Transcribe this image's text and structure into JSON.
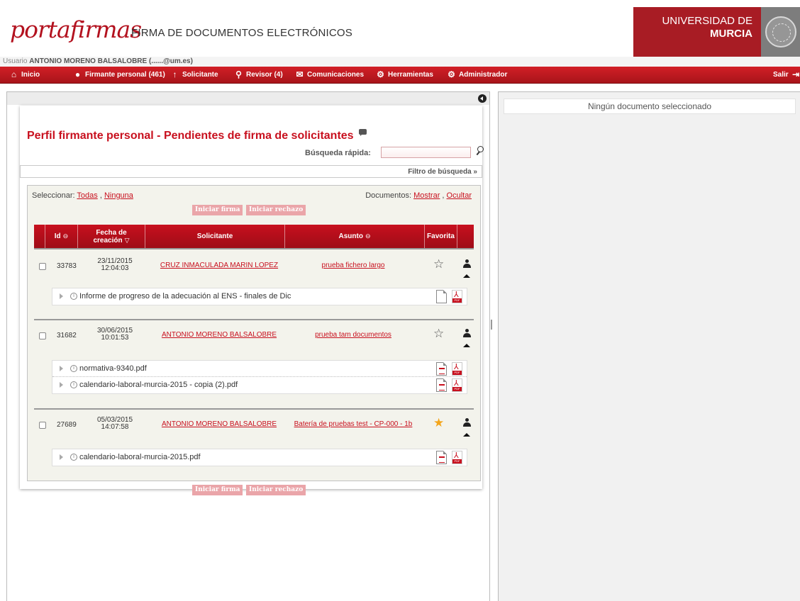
{
  "header": {
    "logo_text": "portafirmas",
    "app_title": "FIRMA DE DOCUMENTOS ELECTRÓNICOS",
    "university_line1": "UNIVERSIDAD DE",
    "university_line2": "MURCIA"
  },
  "user": {
    "prefix": "Usuario",
    "name": "ANTONIO MORENO BALSALOBRE (",
    "email_suffix": "......@um.es)"
  },
  "menu": {
    "inicio": "Inicio",
    "firmante": "Firmante personal (461)",
    "solicitante": "Solicitante",
    "revisor": "Revisor (4)",
    "comunicaciones": "Comunicaciones",
    "herramientas": "Herramientas",
    "administrador": "Administrador",
    "salir": "Salir"
  },
  "page": {
    "title": "Perfil firmante personal - Pendientes de firma de solicitantes",
    "quick_search_label": "Búsqueda rápida:",
    "quick_search_value": "",
    "filter_link": "Filtro de búsqueda »",
    "select_label": "Seleccionar:",
    "select_all": "Todas",
    "select_none": "Ninguna",
    "documents_label": "Documentos:",
    "documents_show": "Mostrar",
    "documents_hide": "Ocultar",
    "start_sign": "Iniciar firma",
    "start_reject": "Iniciar rechazo"
  },
  "table": {
    "headers": {
      "id": "Id",
      "fecha_line1": "Fecha de",
      "fecha_line2": "creación",
      "solicitante": "Solicitante",
      "asunto": "Asunto",
      "favorita": "Favorita"
    },
    "rows": [
      {
        "id": "33783",
        "date": "23/11/2015",
        "time": "12:04:03",
        "solicitante": "CRUZ INMACULADA MARIN LOPEZ",
        "asunto": "prueba fichero largo",
        "favorite": false,
        "docs": [
          "Informe de progreso de la adecuación al ENS - finales de Dic"
        ]
      },
      {
        "id": "31682",
        "date": "30/06/2015",
        "time": "10:01:53",
        "solicitante": "ANTONIO MORENO BALSALOBRE",
        "asunto": "prueba tam documentos",
        "favorite": false,
        "docs": [
          "normativa-9340.pdf",
          "calendario-laboral-murcia-2015 - copia (2).pdf"
        ]
      },
      {
        "id": "27689",
        "date": "05/03/2015",
        "time": "14:07:58",
        "solicitante": "ANTONIO MORENO BALSALOBRE",
        "asunto": "Batería de pruebas test - CP-000 - 1b",
        "favorite": true,
        "docs": [
          "calendario-laboral-murcia-2015.pdf"
        ]
      }
    ]
  },
  "preview": {
    "empty_text": "Ningún documento seleccionado"
  },
  "colors": {
    "brand_red": "#c8101e",
    "university_red": "#a81c24",
    "favorite_star": "#f3a51b"
  }
}
